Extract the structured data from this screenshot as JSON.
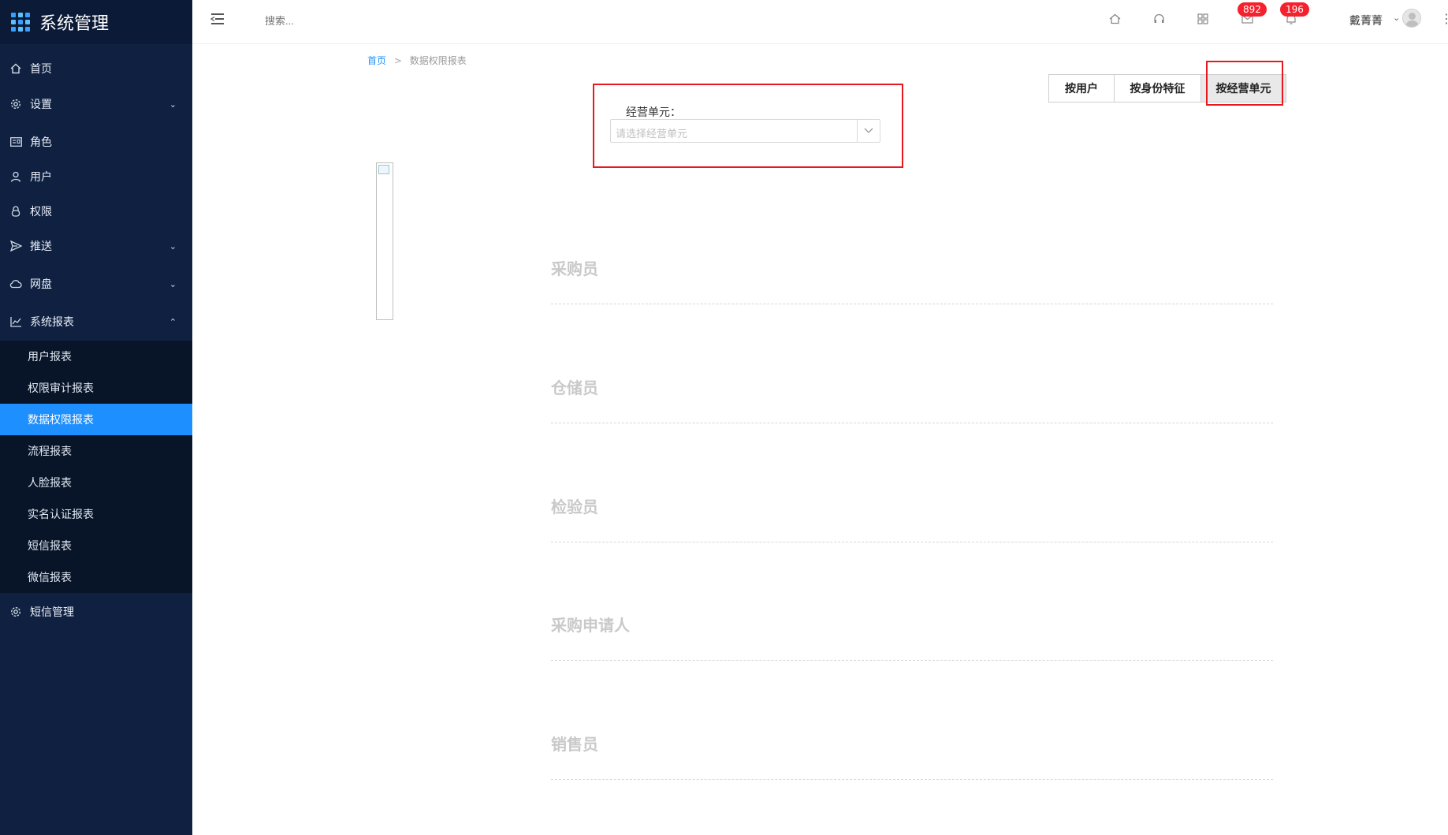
{
  "sidebar": {
    "app_title": "系统管理",
    "items": [
      {
        "label": "首页",
        "icon": "home-icon"
      },
      {
        "label": "设置",
        "icon": "gear-icon"
      },
      {
        "label": "角色",
        "icon": "id-card-icon"
      },
      {
        "label": "用户",
        "icon": "user-icon"
      },
      {
        "label": "权限",
        "icon": "lock-icon"
      },
      {
        "label": "推送",
        "icon": "send-icon"
      },
      {
        "label": "网盘",
        "icon": "cloud-icon"
      },
      {
        "label": "系统报表",
        "icon": "line-chart-icon"
      },
      {
        "label": "短信管理",
        "icon": "gear-icon"
      }
    ],
    "submenu": [
      {
        "label": "用户报表"
      },
      {
        "label": "权限审计报表"
      },
      {
        "label": "数据权限报表",
        "active": true
      },
      {
        "label": "流程报表"
      },
      {
        "label": "人脸报表"
      },
      {
        "label": "实名认证报表"
      },
      {
        "label": "短信报表"
      },
      {
        "label": "微信报表"
      }
    ]
  },
  "topbar": {
    "search_placeholder": "搜索...",
    "mail_badge": "892",
    "bell_badge": "196",
    "username": "戴菁菁"
  },
  "breadcrumb": {
    "home": "首页",
    "separator": ">",
    "current": "数据权限报表"
  },
  "filter": {
    "label": "经营单元：",
    "placeholder": "请选择经营单元"
  },
  "tabs": [
    {
      "label": "按用户"
    },
    {
      "label": "按身份特征"
    },
    {
      "label": "按经营单元",
      "active": true
    }
  ],
  "sections": [
    {
      "title": "采购员"
    },
    {
      "title": "仓储员"
    },
    {
      "title": "检验员"
    },
    {
      "title": "采购申请人"
    },
    {
      "title": "销售员"
    }
  ],
  "colors": {
    "sidebar_bg": "#0f2040",
    "submenu_bg": "#081428",
    "accent": "#1d8fff",
    "badge": "#f5222d",
    "highlight_box": "#e8181f"
  }
}
